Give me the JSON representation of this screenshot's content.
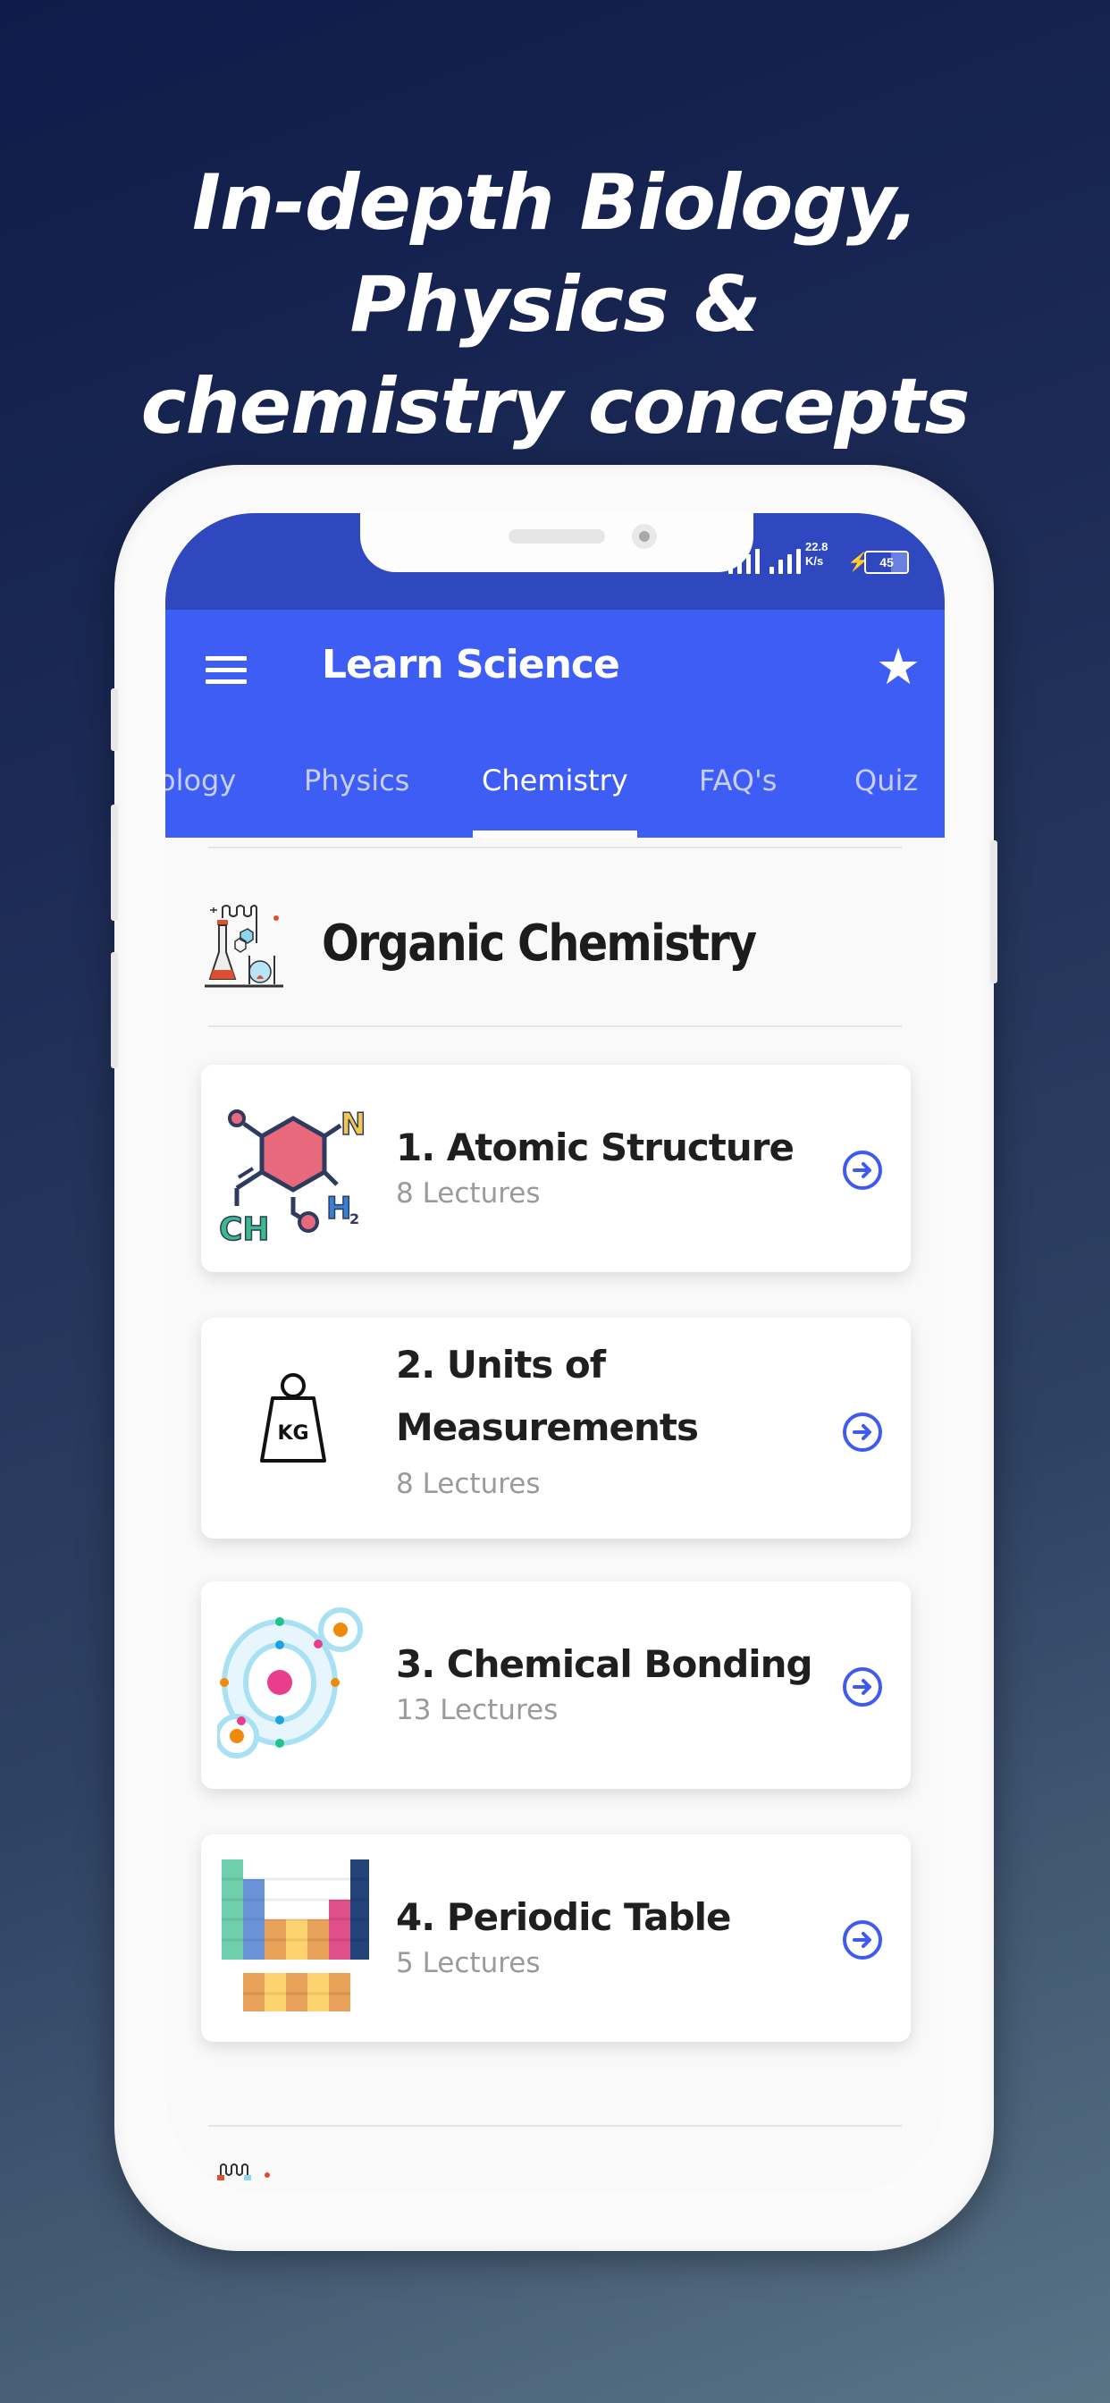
{
  "headline": [
    "In-depth Biology,",
    "Physics &",
    "chemistry concepts"
  ],
  "status_bar": {
    "net_speed_value": "22.8",
    "net_speed_unit": "K/s",
    "battery": "45"
  },
  "app_bar": {
    "title": "Learn Science",
    "menu_icon": "hamburger-menu-icon",
    "action_icon": "star-icon"
  },
  "tabs": [
    {
      "label": "ology",
      "active": false
    },
    {
      "label": "Physics",
      "active": false
    },
    {
      "label": "Chemistry",
      "active": true
    },
    {
      "label": "FAQ's",
      "active": false
    },
    {
      "label": "Quiz",
      "active": false
    }
  ],
  "section": {
    "title": "Organic Chemistry",
    "icon": "lab-flask-icon"
  },
  "topics": [
    {
      "title_lines": [
        "1. Atomic Structure"
      ],
      "lectures": "8 Lectures",
      "icon": "molecule-icon"
    },
    {
      "title_lines": [
        "2. Units of",
        "Measurements"
      ],
      "lectures": "8 Lectures",
      "icon": "kg-weight-icon",
      "icon_text": "KG"
    },
    {
      "title_lines": [
        "3. Chemical Bonding"
      ],
      "lectures": "13 Lectures",
      "icon": "atom-bond-icon"
    },
    {
      "title_lines": [
        "4. Periodic Table"
      ],
      "lectures": "5 Lectures",
      "icon": "periodic-table-icon"
    }
  ],
  "colors": {
    "accent": "#3e5df5",
    "status_bar": "#2f47bf",
    "go_arrow": "#3f5bef"
  }
}
